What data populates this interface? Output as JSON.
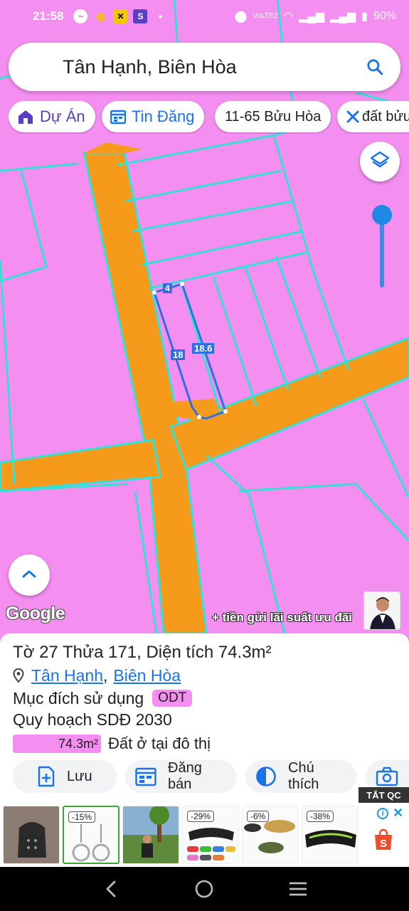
{
  "status_bar": {
    "time": "21:58",
    "network_label": "VoLTE2",
    "battery": "90%"
  },
  "search": {
    "query": "Tân Hạnh, Biên Hòa"
  },
  "chips": [
    {
      "label": "Dự Án",
      "icon": "house-icon"
    },
    {
      "label": "Tin Đăng",
      "icon": "calendar-icon"
    },
    {
      "label": "11-65 Bửu Hòa",
      "icon": ""
    },
    {
      "label": "đất bửu",
      "icon": "tools-icon"
    }
  ],
  "map": {
    "logo": "Google",
    "parcel_labels": {
      "top": "4",
      "left": "18",
      "right": "18.6"
    },
    "promo_text": "+ tiền gửi lãi suất ưu đãi",
    "colors": {
      "land": "#f48ef0",
      "road": "#f59a1b",
      "boundary": "#35e0d4",
      "parcel_outline": "#2f6fe0"
    }
  },
  "info": {
    "title": "Tờ 27 Thửa 171, Diện tích 74.3m²",
    "location": {
      "ward": "Tân Hạnh",
      "separator": ",",
      "city": "Biên Hòa"
    },
    "purpose_label": "Mục đích sử dụng",
    "purpose_code": "ODT",
    "plan_label": "Quy hoạch SDĐ 2030",
    "plan_area": "74.3m²",
    "plan_use": "Đất ở tại đô thị"
  },
  "actions": [
    {
      "label": "Lưu",
      "icon": "save-add-icon"
    },
    {
      "label": "Đăng bán",
      "icon": "post-sale-icon"
    },
    {
      "label": "Chú thích",
      "icon": "legend-icon"
    },
    {
      "label": "",
      "icon": "camera-icon"
    }
  ],
  "ad": {
    "close_label": "TẮT QC",
    "discounts": [
      "-15%",
      "-29%",
      "-6%",
      "-38%"
    ]
  }
}
